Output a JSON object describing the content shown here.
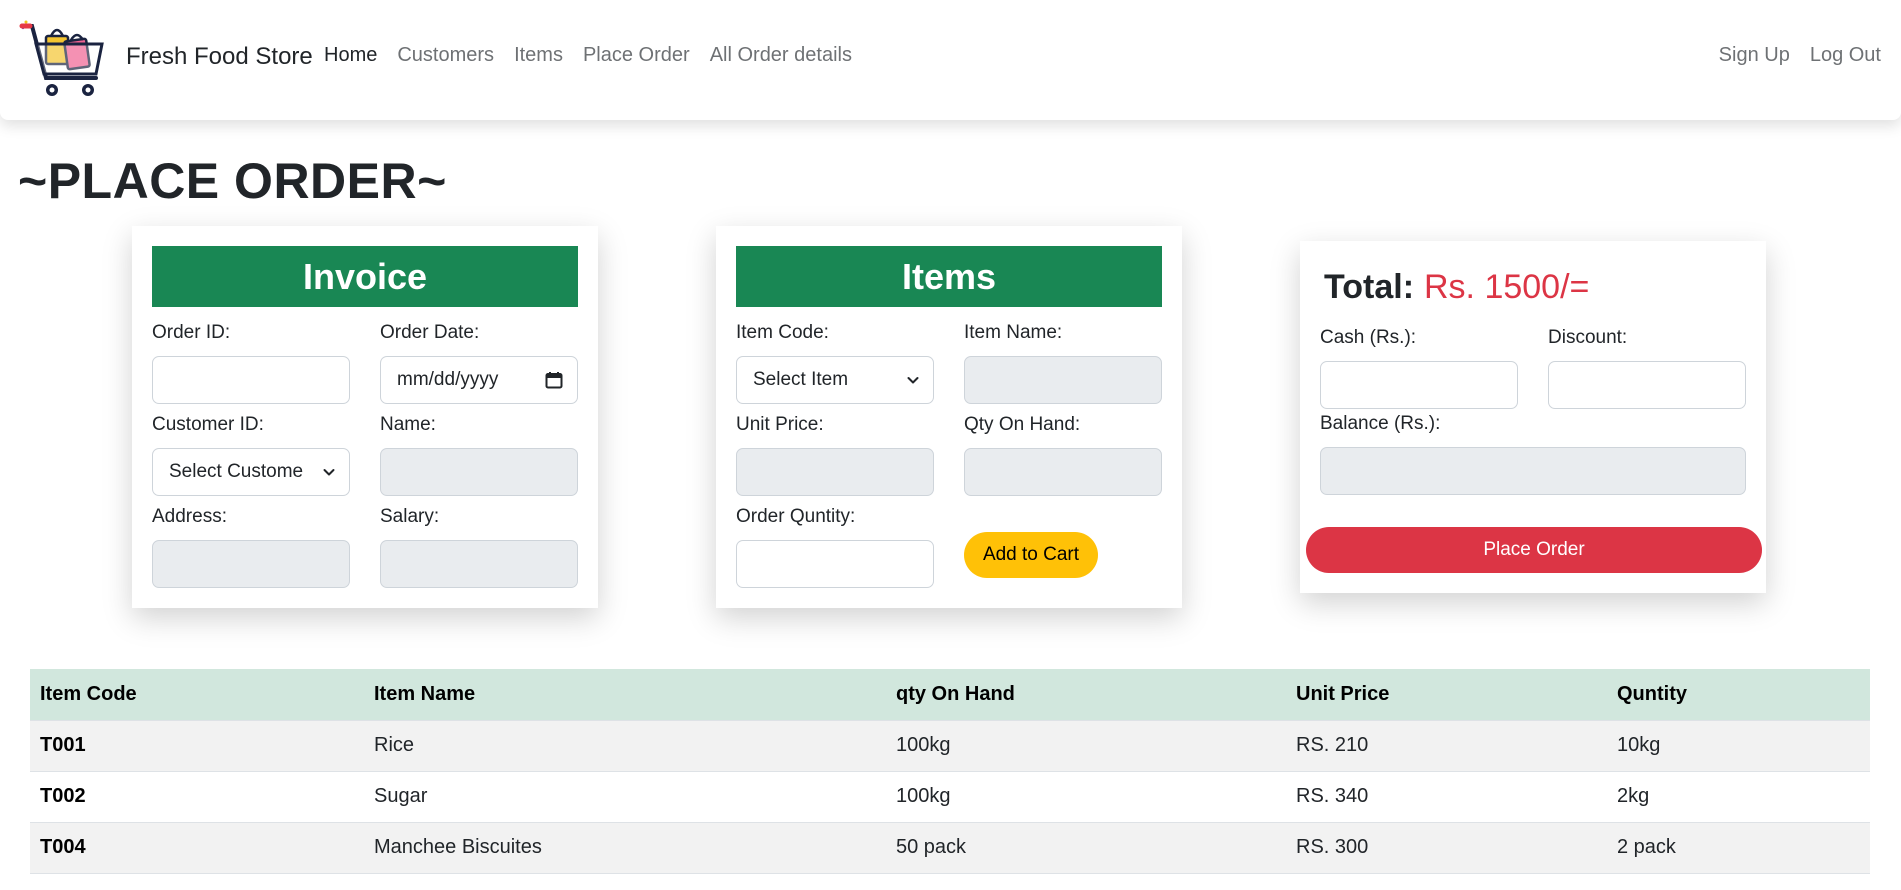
{
  "navbar": {
    "brand": "Fresh Food Store",
    "links": [
      "Home",
      "Customers",
      "Items",
      "Place Order",
      "All Order details"
    ],
    "right_links": [
      "Sign Up",
      "Log Out"
    ]
  },
  "page_title": "~PLACE ORDER~",
  "invoice": {
    "header": "Invoice",
    "order_id_label": "Order ID:",
    "order_date_label": "Order Date:",
    "order_date_placeholder": "mm/dd/yyyy",
    "customer_id_label": "Customer ID:",
    "customer_select": "Select Custome",
    "name_label": "Name:",
    "address_label": "Address:",
    "salary_label": "Salary:"
  },
  "items": {
    "header": "Items",
    "item_code_label": "Item Code:",
    "item_select": "Select Item",
    "item_name_label": "Item Name:",
    "unit_price_label": "Unit Price:",
    "qty_on_hand_label": "Qty On Hand:",
    "order_qty_label": "Order Quntity:",
    "add_to_cart": "Add to Cart"
  },
  "summary": {
    "total_label": "Total:",
    "total_value": "Rs. 1500/=",
    "cash_label": "Cash (Rs.):",
    "discount_label": "Discount:",
    "balance_label": "Balance (Rs.):",
    "place_order": "Place Order"
  },
  "table": {
    "headers": [
      "Item Code",
      "Item Name",
      "qty On Hand",
      "Unit Price",
      "Quntity"
    ],
    "rows": [
      [
        "T001",
        "Rice",
        "100kg",
        "RS. 210",
        "10kg"
      ],
      [
        "T002",
        "Sugar",
        "100kg",
        "RS. 340",
        "2kg"
      ],
      [
        "T004",
        "Manchee Biscuites",
        "50 pack",
        "RS. 300",
        "2 pack"
      ]
    ]
  },
  "colors": {
    "green": "#198754",
    "red": "#dc3545",
    "yellow": "#ffc107",
    "table_header": "#d1e7dd"
  }
}
